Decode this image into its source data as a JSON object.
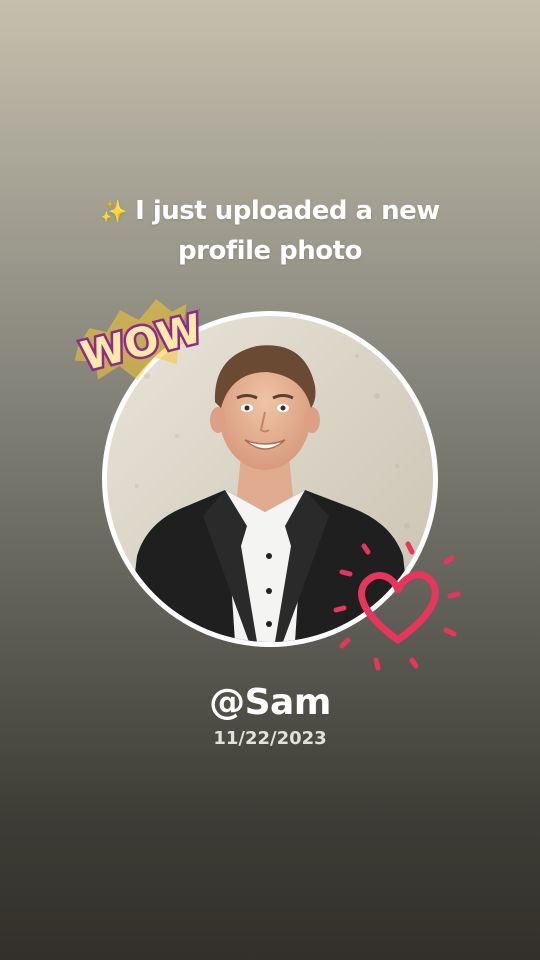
{
  "story": {
    "headline_icon": "sparkles-icon",
    "headline_sparkle": "✨",
    "headline_text": "I just uploaded a new profile photo",
    "username": "@Sam",
    "date": "11/22/2023",
    "stickers": {
      "wow_text": "WOW!",
      "wow_colors": {
        "fill": "#fde9a8",
        "outline": "#8e2a8c"
      },
      "heart_icon": "heart-icon",
      "heart_color": "#e8355c"
    }
  }
}
